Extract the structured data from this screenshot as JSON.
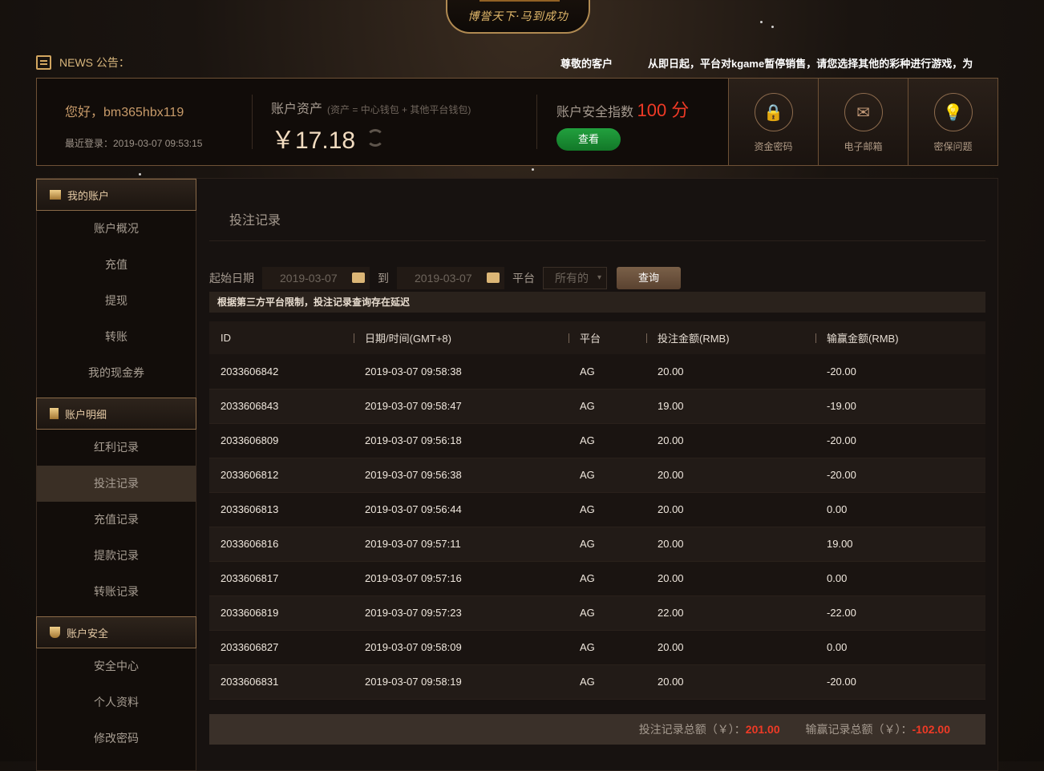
{
  "logo": {
    "slogan": "博誉天下·马到成功"
  },
  "news": {
    "label": "NEWS 公告：",
    "messages": [
      "尊敬的客户",
      "从即日起，平台对kgame暂停销售，请您选择其他的彩种进行游戏，为"
    ]
  },
  "account": {
    "greeting": "您好，bm365hbx119",
    "last_login": "最近登录：2019-03-07 09:53:15",
    "assets_label": "账户资产",
    "assets_note": "(资产 = 中心钱包 + 其他平台钱包)",
    "balance": "￥17.18",
    "security_label": "账户安全指数",
    "security_score": "100 分",
    "view_button": "查看",
    "tiles": [
      {
        "label": "资金密码",
        "icon": "lock-icon"
      },
      {
        "label": "电子邮箱",
        "icon": "mail-icon"
      },
      {
        "label": "密保问题",
        "icon": "bulb-icon"
      }
    ]
  },
  "sidebar": {
    "sections": [
      {
        "title": "我的账户",
        "items": [
          "账户概况",
          "充值",
          "提现",
          "转账",
          "我的现金券"
        ]
      },
      {
        "title": "账户明细",
        "items": [
          "红利记录",
          "投注记录",
          "充值记录",
          "提款记录",
          "转账记录"
        ]
      },
      {
        "title": "账户安全",
        "items": [
          "安全中心",
          "个人资料",
          "修改密码"
        ]
      }
    ],
    "active": "投注记录"
  },
  "main": {
    "title": "投注记录",
    "filters": {
      "start_label": "起始日期",
      "start": "2019-03-07",
      "to_label": "到",
      "end": "2019-03-07",
      "platform_label": "平台",
      "platform": "所有的",
      "query": "查询"
    },
    "notice": "根据第三方平台限制，投注记录查询存在延迟",
    "columns": [
      "ID",
      "日期/时间(GMT+8)",
      "平台",
      "投注金额(RMB)",
      "输赢金额(RMB)"
    ],
    "rows": [
      [
        "2033606842",
        "2019-03-07 09:58:38",
        "AG",
        "20.00",
        "-20.00"
      ],
      [
        "2033606843",
        "2019-03-07 09:58:47",
        "AG",
        "19.00",
        "-19.00"
      ],
      [
        "2033606809",
        "2019-03-07 09:56:18",
        "AG",
        "20.00",
        "-20.00"
      ],
      [
        "2033606812",
        "2019-03-07 09:56:38",
        "AG",
        "20.00",
        "-20.00"
      ],
      [
        "2033606813",
        "2019-03-07 09:56:44",
        "AG",
        "20.00",
        "0.00"
      ],
      [
        "2033606816",
        "2019-03-07 09:57:11",
        "AG",
        "20.00",
        "19.00"
      ],
      [
        "2033606817",
        "2019-03-07 09:57:16",
        "AG",
        "20.00",
        "0.00"
      ],
      [
        "2033606819",
        "2019-03-07 09:57:23",
        "AG",
        "22.00",
        "-22.00"
      ],
      [
        "2033606827",
        "2019-03-07 09:58:09",
        "AG",
        "20.00",
        "0.00"
      ],
      [
        "2033606831",
        "2019-03-07 09:58:19",
        "AG",
        "20.00",
        "-20.00"
      ]
    ],
    "summary": {
      "bet_label": "投注记录总额（￥）：",
      "bet_total": "201.00",
      "win_label": "输赢记录总额（￥）：",
      "win_total": "-102.00"
    }
  }
}
